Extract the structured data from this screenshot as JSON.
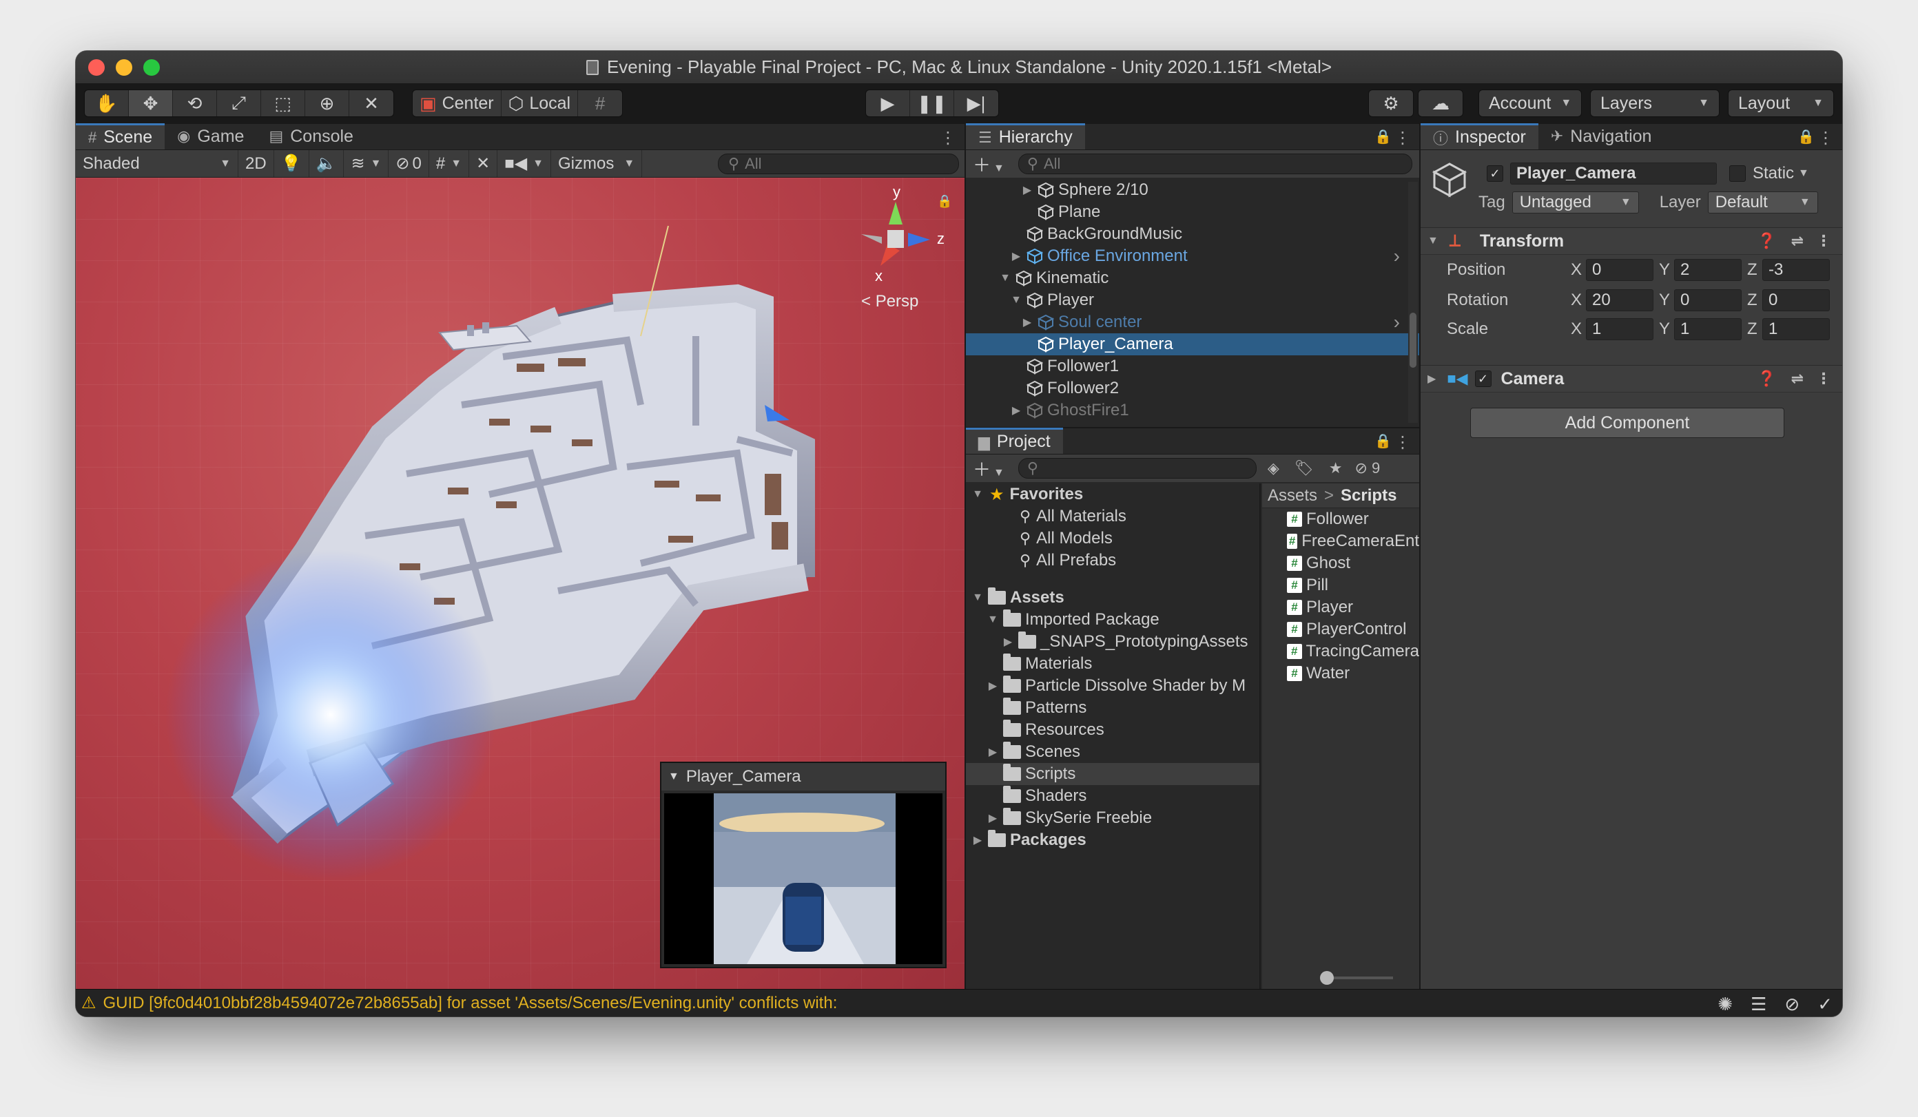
{
  "window": {
    "title": "Evening - Playable Final Project - PC, Mac & Linux Standalone - Unity 2020.1.15f1 <Metal>"
  },
  "toolbar": {
    "pivot_label": "Center",
    "space_label": "Local",
    "account_label": "Account",
    "layers_label": "Layers",
    "layout_label": "Layout"
  },
  "scene_panel": {
    "tabs": [
      {
        "label": "Scene",
        "icon": "grid-icon"
      },
      {
        "label": "Game",
        "icon": "gamepad-icon"
      },
      {
        "label": "Console",
        "icon": "console-icon"
      }
    ],
    "draw_mode": "Shaded",
    "mode_2d": "2D",
    "hidden_count": "0",
    "gizmos_label": "Gizmos",
    "search_placeholder": "All",
    "gizmo_axes": {
      "y": "y",
      "z": "z",
      "x": "x"
    },
    "projection_label": "Persp",
    "camera_preview_title": "Player_Camera"
  },
  "hierarchy": {
    "tab_label": "Hierarchy",
    "search_placeholder": "All",
    "rows": [
      {
        "label": "Sphere 2/10",
        "indent": 5,
        "arrow": "right",
        "style": "normal"
      },
      {
        "label": "Plane",
        "indent": 5,
        "arrow": "none",
        "style": "normal"
      },
      {
        "label": "BackGroundMusic",
        "indent": 4,
        "arrow": "none",
        "style": "normal"
      },
      {
        "label": "Office Environment",
        "indent": 4,
        "arrow": "right",
        "style": "blue"
      },
      {
        "label": "Kinematic",
        "indent": 3,
        "arrow": "down",
        "style": "normal"
      },
      {
        "label": "Player",
        "indent": 4,
        "arrow": "down",
        "style": "normal"
      },
      {
        "label": "Soul center",
        "indent": 5,
        "arrow": "right",
        "style": "dim-blue"
      },
      {
        "label": "Player_Camera",
        "indent": 5,
        "arrow": "none",
        "style": "selected"
      },
      {
        "label": "Follower1",
        "indent": 4,
        "arrow": "none",
        "style": "normal"
      },
      {
        "label": "Follower2",
        "indent": 4,
        "arrow": "none",
        "style": "normal"
      },
      {
        "label": "GhostFire1",
        "indent": 4,
        "arrow": "right",
        "style": "dim"
      }
    ]
  },
  "project": {
    "tab_label": "Project",
    "visible_count": "9",
    "tree": [
      {
        "label": "Favorites",
        "indent": 0,
        "arrow": "down",
        "kind": "star",
        "bold": true
      },
      {
        "label": "All Materials",
        "indent": 2,
        "arrow": "none",
        "kind": "search"
      },
      {
        "label": "All Models",
        "indent": 2,
        "arrow": "none",
        "kind": "search"
      },
      {
        "label": "All Prefabs",
        "indent": 2,
        "arrow": "none",
        "kind": "search"
      },
      {
        "label": "",
        "indent": 0,
        "arrow": "none",
        "kind": "spacer"
      },
      {
        "label": "Assets",
        "indent": 0,
        "arrow": "down",
        "kind": "folder",
        "bold": true
      },
      {
        "label": "Imported Package",
        "indent": 1,
        "arrow": "down",
        "kind": "folder"
      },
      {
        "label": "_SNAPS_PrototypingAssets",
        "indent": 2,
        "arrow": "right",
        "kind": "folder"
      },
      {
        "label": "Materials",
        "indent": 1,
        "arrow": "none",
        "kind": "folder"
      },
      {
        "label": "Particle Dissolve Shader by M",
        "indent": 1,
        "arrow": "right",
        "kind": "folder"
      },
      {
        "label": "Patterns",
        "indent": 1,
        "arrow": "none",
        "kind": "folder"
      },
      {
        "label": "Resources",
        "indent": 1,
        "arrow": "none",
        "kind": "folder"
      },
      {
        "label": "Scenes",
        "indent": 1,
        "arrow": "right",
        "kind": "folder"
      },
      {
        "label": "Scripts",
        "indent": 1,
        "arrow": "none",
        "kind": "folder",
        "selected": true
      },
      {
        "label": "Shaders",
        "indent": 1,
        "arrow": "none",
        "kind": "folder"
      },
      {
        "label": "SkySerie Freebie",
        "indent": 1,
        "arrow": "right",
        "kind": "folder"
      },
      {
        "label": "Packages",
        "indent": 0,
        "arrow": "right",
        "kind": "folder",
        "bold": true
      }
    ],
    "breadcrumb": [
      "Assets",
      "Scripts"
    ],
    "breadcrumb_sep": ">",
    "scripts": [
      "Follower",
      "FreeCameraEnt",
      "Ghost",
      "Pill",
      "Player",
      "PlayerControl",
      "TracingCamera",
      "Water"
    ]
  },
  "inspector": {
    "tabs": [
      {
        "label": "Inspector",
        "icon": "info-icon"
      },
      {
        "label": "Navigation",
        "icon": "navigation-icon"
      }
    ],
    "object_name": "Player_Camera",
    "static_label": "Static",
    "tag_label": "Tag",
    "tag_value": "Untagged",
    "layer_label": "Layer",
    "layer_value": "Default",
    "transform": {
      "title": "Transform",
      "rows": [
        {
          "label": "Position",
          "x": "0",
          "y": "2",
          "z": "-3"
        },
        {
          "label": "Rotation",
          "x": "20",
          "y": "0",
          "z": "0"
        },
        {
          "label": "Scale",
          "x": "1",
          "y": "1",
          "z": "1"
        }
      ],
      "axis_x": "X",
      "axis_y": "Y",
      "axis_z": "Z"
    },
    "camera_component": "Camera",
    "add_component": "Add Component"
  },
  "status": {
    "message": "GUID [9fc0d4010bbf28b4594072e72b8655ab] for asset 'Assets/Scenes/Evening.unity' conflicts with:"
  },
  "colors": {
    "selection": "#2c5d87",
    "accent_tab": "#3a79bb",
    "scene_bg": "#b8424b",
    "warning": "#e0b020"
  }
}
